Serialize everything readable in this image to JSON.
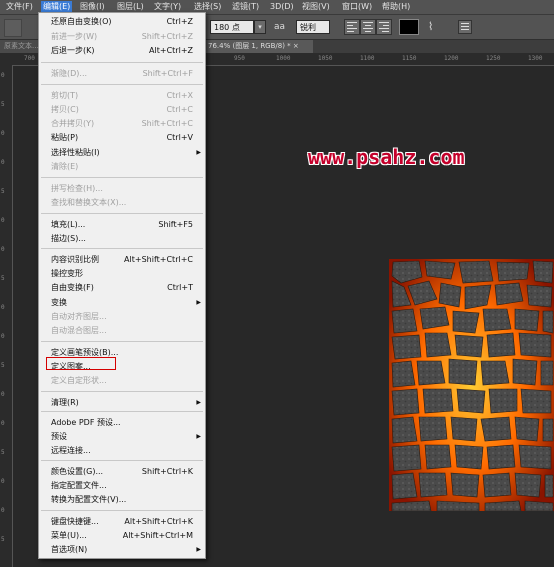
{
  "menubar": [
    {
      "label": "文件(F)",
      "active": false
    },
    {
      "label": "编辑(E)",
      "active": true
    },
    {
      "label": "图像(I)",
      "active": false
    },
    {
      "label": "图层(L)",
      "active": false
    },
    {
      "label": "文字(Y)",
      "active": false
    },
    {
      "label": "选择(S)",
      "active": false
    },
    {
      "label": "滤镜(T)",
      "active": false
    },
    {
      "label": "3D(D)",
      "active": false
    },
    {
      "label": "视图(V)",
      "active": false
    },
    {
      "label": "窗口(W)",
      "active": false
    },
    {
      "label": "帮助(H)",
      "active": false
    }
  ],
  "options": {
    "font_size": "180 点",
    "antialias_icon": "aa",
    "antialias": "锐利",
    "text_color": "#000000"
  },
  "tabs": {
    "left_tab": "原素文本...",
    "document_tab": "76.4% (图层 1, RGB/8) * ×"
  },
  "ruler": {
    "h": [
      "700",
      "750",
      "800",
      "850",
      "900",
      "950",
      "1000",
      "1050",
      "1100",
      "1150",
      "1200",
      "1250",
      "1300"
    ],
    "v": [
      "0",
      "5",
      "0",
      "0",
      "5",
      "0",
      "0",
      "5",
      "0",
      "0",
      "5",
      "0",
      "0",
      "5",
      "0",
      "0",
      "5"
    ]
  },
  "watermark": "www.psahz.com",
  "menu": {
    "items": [
      {
        "label": "还原自由变换(O)",
        "shortcut": "Ctrl+Z",
        "disabled": false,
        "submenu": false
      },
      {
        "label": "前进一步(W)",
        "shortcut": "Shift+Ctrl+Z",
        "disabled": true,
        "submenu": false
      },
      {
        "label": "后退一步(K)",
        "shortcut": "Alt+Ctrl+Z",
        "disabled": false,
        "submenu": false
      },
      {
        "label": "渐隐(D)...",
        "shortcut": "Shift+Ctrl+F",
        "disabled": true,
        "submenu": false
      },
      {
        "label": "剪切(T)",
        "shortcut": "Ctrl+X",
        "disabled": true,
        "submenu": false
      },
      {
        "label": "拷贝(C)",
        "shortcut": "Ctrl+C",
        "disabled": true,
        "submenu": false
      },
      {
        "label": "合并拷贝(Y)",
        "shortcut": "Shift+Ctrl+C",
        "disabled": true,
        "submenu": false
      },
      {
        "label": "粘贴(P)",
        "shortcut": "Ctrl+V",
        "disabled": false,
        "submenu": false
      },
      {
        "label": "选择性粘贴(I)",
        "shortcut": "",
        "disabled": false,
        "submenu": true
      },
      {
        "label": "清除(E)",
        "shortcut": "",
        "disabled": true,
        "submenu": false
      },
      {
        "label": "拼写检查(H)...",
        "shortcut": "",
        "disabled": true,
        "submenu": false
      },
      {
        "label": "查找和替换文本(X)...",
        "shortcut": "",
        "disabled": true,
        "submenu": false
      },
      {
        "label": "填充(L)...",
        "shortcut": "Shift+F5",
        "disabled": false,
        "submenu": false
      },
      {
        "label": "描边(S)...",
        "shortcut": "",
        "disabled": false,
        "submenu": false
      },
      {
        "label": "内容识别比例",
        "shortcut": "Alt+Shift+Ctrl+C",
        "disabled": false,
        "submenu": false
      },
      {
        "label": "操控变形",
        "shortcut": "",
        "disabled": false,
        "submenu": false
      },
      {
        "label": "自由变换(F)",
        "shortcut": "Ctrl+T",
        "disabled": false,
        "submenu": false
      },
      {
        "label": "变换",
        "shortcut": "",
        "disabled": false,
        "submenu": true
      },
      {
        "label": "自动对齐图层...",
        "shortcut": "",
        "disabled": true,
        "submenu": false
      },
      {
        "label": "自动混合图层...",
        "shortcut": "",
        "disabled": true,
        "submenu": false
      },
      {
        "label": "定义画笔预设(B)...",
        "shortcut": "",
        "disabled": false,
        "submenu": false
      },
      {
        "label": "定义图案...",
        "shortcut": "",
        "disabled": false,
        "submenu": false
      },
      {
        "label": "定义自定形状...",
        "shortcut": "",
        "disabled": true,
        "submenu": false
      },
      {
        "label": "清理(R)",
        "shortcut": "",
        "disabled": false,
        "submenu": true
      },
      {
        "label": "Adobe PDF 预设...",
        "shortcut": "",
        "disabled": false,
        "submenu": false
      },
      {
        "label": "预设",
        "shortcut": "",
        "disabled": false,
        "submenu": true
      },
      {
        "label": "远程连接...",
        "shortcut": "",
        "disabled": false,
        "submenu": false
      },
      {
        "label": "颜色设置(G)...",
        "shortcut": "Shift+Ctrl+K",
        "disabled": false,
        "submenu": false
      },
      {
        "label": "指定配置文件...",
        "shortcut": "",
        "disabled": false,
        "submenu": false
      },
      {
        "label": "转换为配置文件(V)...",
        "shortcut": "",
        "disabled": false,
        "submenu": false
      },
      {
        "label": "键盘快捷键...",
        "shortcut": "Alt+Shift+Ctrl+K",
        "disabled": false,
        "submenu": false
      },
      {
        "label": "菜单(U)...",
        "shortcut": "Alt+Shift+Ctrl+M",
        "disabled": false,
        "submenu": false
      },
      {
        "label": "首选项(N)",
        "shortcut": "",
        "disabled": false,
        "submenu": true
      }
    ],
    "highlighted_item": "定义图案..."
  }
}
